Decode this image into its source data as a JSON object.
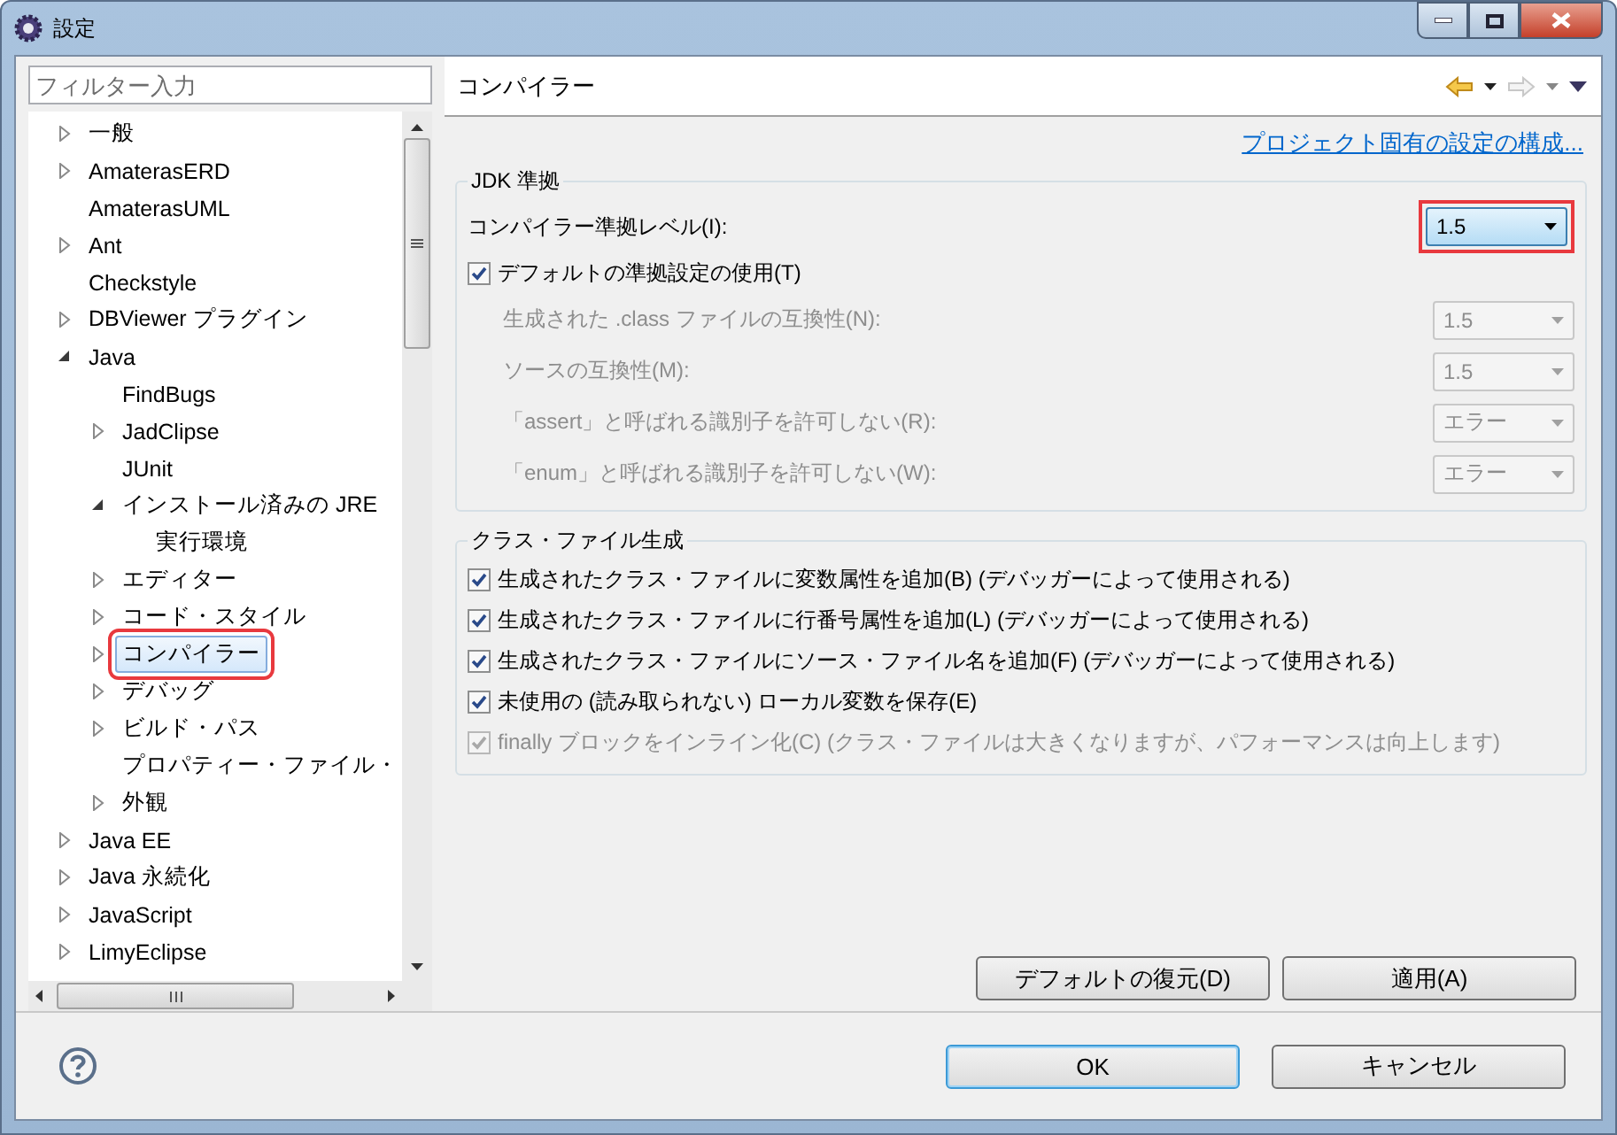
{
  "window": {
    "title": "設定"
  },
  "filter": {
    "placeholder": "フィルター入力"
  },
  "tree": [
    {
      "label": "一般",
      "expanded": false,
      "selected": false,
      "highlighted": false
    },
    {
      "label": "AmaterasERD",
      "expanded": false,
      "selected": false,
      "highlighted": false
    },
    {
      "label": "AmaterasUML",
      "selected": false,
      "highlighted": false
    },
    {
      "label": "Ant",
      "expanded": false,
      "selected": false,
      "highlighted": false
    },
    {
      "label": "Checkstyle",
      "selected": false,
      "highlighted": false
    },
    {
      "label": "DBViewer プラグイン",
      "expanded": false,
      "selected": false,
      "highlighted": false
    },
    {
      "label": "Java",
      "expanded": true,
      "selected": false,
      "highlighted": false,
      "children": [
        {
          "label": "FindBugs",
          "selected": false,
          "highlighted": false
        },
        {
          "label": "JadClipse",
          "expanded": false,
          "selected": false,
          "highlighted": false
        },
        {
          "label": "JUnit",
          "selected": false,
          "highlighted": false
        },
        {
          "label": "インストール済みの JRE",
          "expanded": true,
          "selected": false,
          "highlighted": false,
          "children": [
            {
              "label": "実行環境",
              "selected": false,
              "highlighted": false
            }
          ]
        },
        {
          "label": "エディター",
          "expanded": false,
          "selected": false,
          "highlighted": false
        },
        {
          "label": "コード・スタイル",
          "expanded": false,
          "selected": false,
          "highlighted": false
        },
        {
          "label": "コンパイラー",
          "expanded": false,
          "selected": true,
          "highlighted": true
        },
        {
          "label": "デバッグ",
          "expanded": false,
          "selected": false,
          "highlighted": false
        },
        {
          "label": "ビルド・パス",
          "expanded": false,
          "selected": false,
          "highlighted": false
        },
        {
          "label": "プロパティー・ファイル・",
          "selected": false,
          "highlighted": false
        },
        {
          "label": "外観",
          "expanded": false,
          "selected": false,
          "highlighted": false
        }
      ]
    },
    {
      "label": "Java EE",
      "expanded": false,
      "selected": false,
      "highlighted": false
    },
    {
      "label": "Java 永続化",
      "expanded": false,
      "selected": false,
      "highlighted": false
    },
    {
      "label": "JavaScript",
      "expanded": false,
      "selected": false,
      "highlighted": false
    },
    {
      "label": "LimyEclipse",
      "expanded": false,
      "selected": false,
      "highlighted": false
    }
  ],
  "page": {
    "title": "コンパイラー",
    "link": "プロジェクト固有の設定の構成...",
    "groups": [
      {
        "title": "JDK 準拠",
        "rows": [
          {
            "kind": "combo",
            "label": "コンパイラー準拠レベル(I):",
            "value": "1.5",
            "disabled": false,
            "highlighted": true
          },
          {
            "kind": "checkbox",
            "label": "デフォルトの準拠設定の使用(T)",
            "checked": true,
            "disabled": false,
            "children": [
              {
                "kind": "combo",
                "label": "生成された .class ファイルの互換性(N):",
                "value": "1.5",
                "disabled": true
              },
              {
                "kind": "combo",
                "label": "ソースの互換性(M):",
                "value": "1.5",
                "disabled": true
              },
              {
                "kind": "combo",
                "label": "「assert」と呼ばれる識別子を許可しない(R):",
                "value": "エラー",
                "disabled": true
              },
              {
                "kind": "combo",
                "label": "「enum」と呼ばれる識別子を許可しない(W):",
                "value": "エラー",
                "disabled": true
              }
            ]
          }
        ]
      },
      {
        "title": "クラス・ファイル生成",
        "rows": [
          {
            "kind": "checkbox",
            "label": "生成されたクラス・ファイルに変数属性を追加(B) (デバッガーによって使用される)",
            "checked": true,
            "disabled": false
          },
          {
            "kind": "checkbox",
            "label": "生成されたクラス・ファイルに行番号属性を追加(L) (デバッガーによって使用される)",
            "checked": true,
            "disabled": false
          },
          {
            "kind": "checkbox",
            "label": "生成されたクラス・ファイルにソース・ファイル名を追加(F) (デバッガーによって使用される)",
            "checked": true,
            "disabled": false
          },
          {
            "kind": "checkbox",
            "label": "未使用の (読み取られない) ローカル変数を保存(E)",
            "checked": true,
            "disabled": false
          },
          {
            "kind": "checkbox",
            "label": "finally ブロックをインライン化(C) (クラス・ファイルは大きくなりますが、パフォーマンスは向上します)",
            "checked": true,
            "disabled": true
          }
        ]
      }
    ],
    "buttons": [
      {
        "label": "デフォルトの復元(D)",
        "default": false
      },
      {
        "label": "適用(A)",
        "default": false
      }
    ]
  },
  "dialog_buttons": [
    {
      "label": "OK",
      "default": true
    },
    {
      "label": "キャンセル",
      "default": false
    }
  ]
}
